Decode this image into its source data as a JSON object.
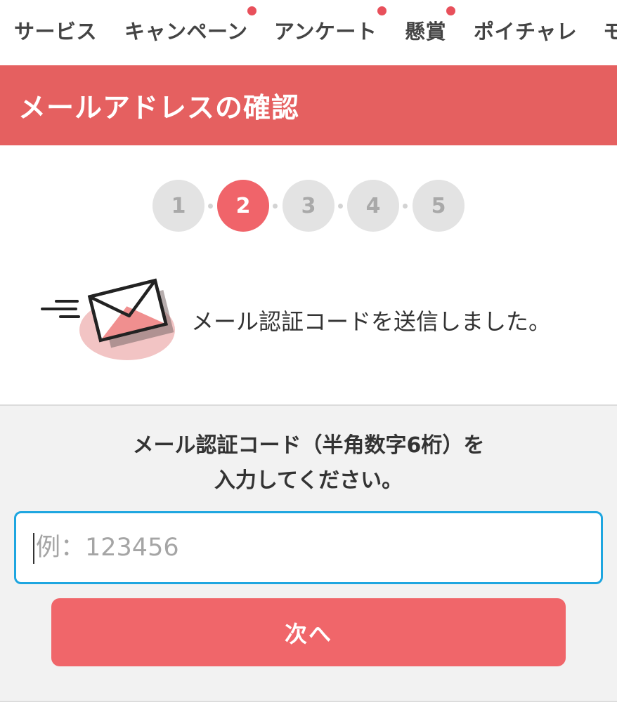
{
  "nav": {
    "items": [
      {
        "label": "サービス"
      },
      {
        "label": "キャンペーン"
      },
      {
        "label": "アンケート"
      },
      {
        "label": "懸賞"
      },
      {
        "label": "ポイチャレ"
      },
      {
        "label": "モ"
      }
    ]
  },
  "header": {
    "title": "メールアドレスの確認"
  },
  "steps": [
    "1",
    "2",
    "3",
    "4",
    "5"
  ],
  "message": {
    "text": "メール認証コードを送信しました。",
    "icon": "mail-sent-icon"
  },
  "form": {
    "instruction_line1": "メール認証コード（半角数字6桁）を",
    "instruction_line2": "入力してください。",
    "input_placeholder": "例：123456",
    "input_value": "",
    "next_label": "次へ"
  },
  "colors": {
    "header_bg": "#e56060",
    "accent": "#f0646a",
    "input_border": "#1ea6e0",
    "badge_dot": "#e8505b"
  }
}
